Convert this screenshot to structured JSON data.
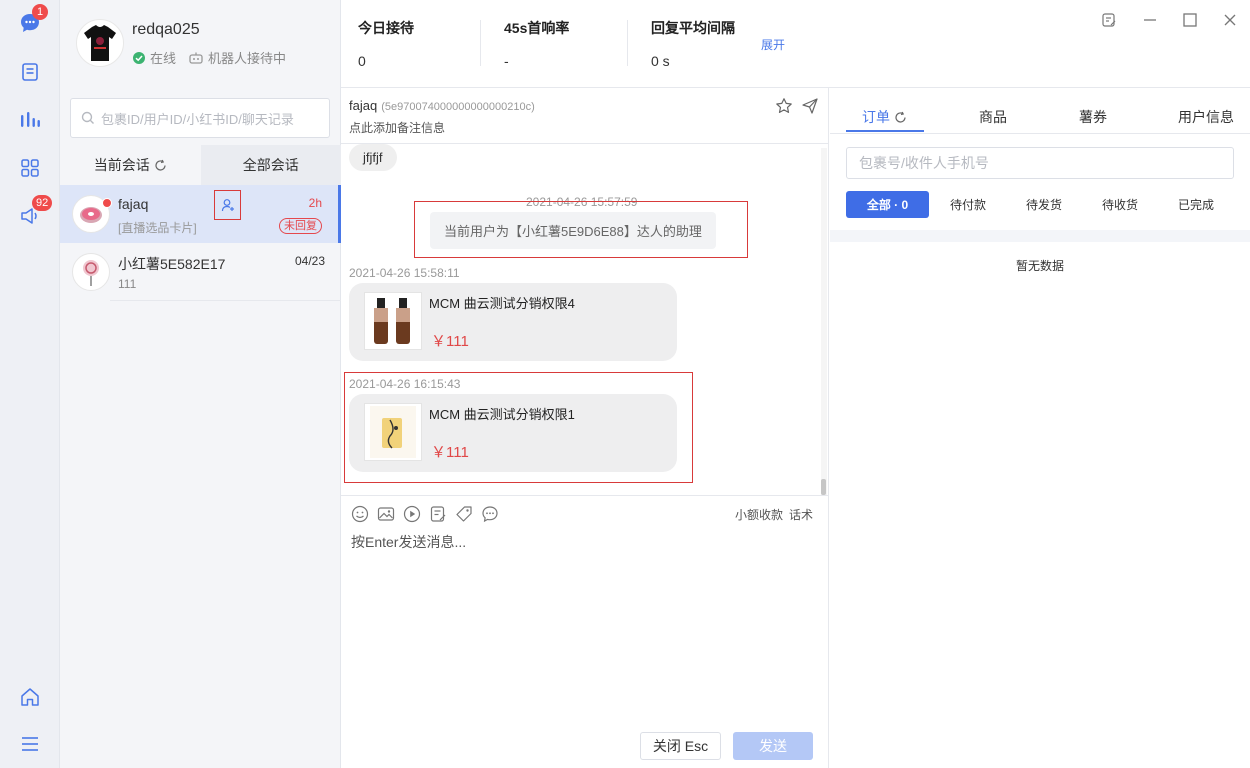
{
  "rail": {
    "messages_badge": "1",
    "notify_badge": "92"
  },
  "profile": {
    "username": "redqa025",
    "online_status": "在线",
    "robot_status": "机器人接待中"
  },
  "conversations": {
    "search_placeholder": "包裹ID/用户ID/小红书ID/聊天记录",
    "tab_current": "当前会话",
    "tab_all": "全部会话",
    "items": [
      {
        "name": "fajaq",
        "preview": "[直播选品卡片]",
        "time": "2h",
        "tag": "未回复"
      },
      {
        "name": "小红薯5E582E17",
        "preview": "111",
        "time": "04/23"
      }
    ]
  },
  "stats": {
    "today_label": "今日接待",
    "today_value": "0",
    "first_resp_label": "45s首响率",
    "first_resp_value": "-",
    "avg_label": "回复平均间隔",
    "avg_value": "0 s",
    "expand": "展开"
  },
  "chat": {
    "user_name": "fajaq",
    "user_id": "(5e970074000000000000210c)",
    "note_hint": "点此添加备注信息",
    "messages": [
      {
        "type": "text",
        "text": "jfjfjf"
      },
      {
        "type": "system",
        "time": "2021-04-26 15:57:59",
        "text": "当前用户为【小红薯5E9D6E88】达人的助理"
      },
      {
        "type": "card",
        "time": "2021-04-26 15:58:11",
        "title": "MCM 曲云测试分销权限4",
        "price": "￥111"
      },
      {
        "type": "card",
        "time": "2021-04-26 16:15:43",
        "title": "MCM 曲云测试分销权限1",
        "price": "￥111"
      }
    ],
    "tool_link_1": "小额收款",
    "tool_link_2": "话术",
    "input_placeholder": "按Enter发送消息...",
    "close_button": "关闭 Esc",
    "send_button": "发送"
  },
  "right_panel": {
    "tabs": [
      "订单",
      "商品",
      "薯券",
      "用户信息"
    ],
    "search_placeholder": "包裹号/收件人手机号",
    "filters": [
      "全部 · 0",
      "待付款",
      "待发货",
      "待收货",
      "已完成"
    ],
    "empty_text": "暂无数据"
  },
  "colors": {
    "accent": "#4a78e8",
    "alert": "#e5484d",
    "price": "#e04848",
    "highlight_box": "#d83a3a"
  }
}
